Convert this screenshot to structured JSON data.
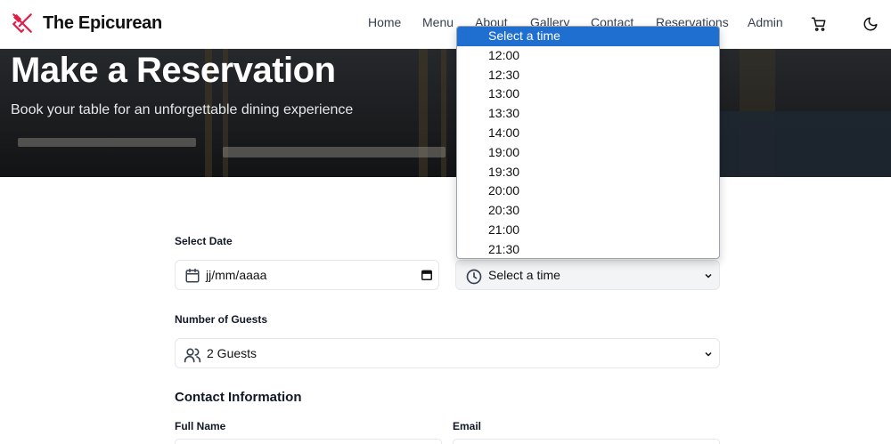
{
  "brand": {
    "name": "The Epicurean",
    "accent": "#e11d48"
  },
  "nav": {
    "items": [
      "Home",
      "Menu",
      "About",
      "Gallery",
      "Contact",
      "Reservations",
      "Admin"
    ]
  },
  "hero": {
    "title": "Make a Reservation",
    "subtitle": "Book your table for an unforgettable dining experience"
  },
  "form": {
    "date_label": "Select Date",
    "date_value": "jj/mm/aaaa",
    "time_value": "Select a time",
    "guests_label": "Number of Guests",
    "guests_value": "2 Guests",
    "contact_title": "Contact Information",
    "full_name_label": "Full Name",
    "email_label": "Email"
  },
  "time_dropdown": {
    "options": [
      "Select a time",
      "12:00",
      "12:30",
      "13:00",
      "13:30",
      "14:00",
      "19:00",
      "19:30",
      "20:00",
      "20:30",
      "21:00",
      "21:30"
    ],
    "selected": "Select a time"
  },
  "icons": [
    "utensils-icon",
    "cart-icon",
    "moon-icon",
    "calendar-icon",
    "clock-icon",
    "users-icon",
    "chevron-down-icon"
  ]
}
